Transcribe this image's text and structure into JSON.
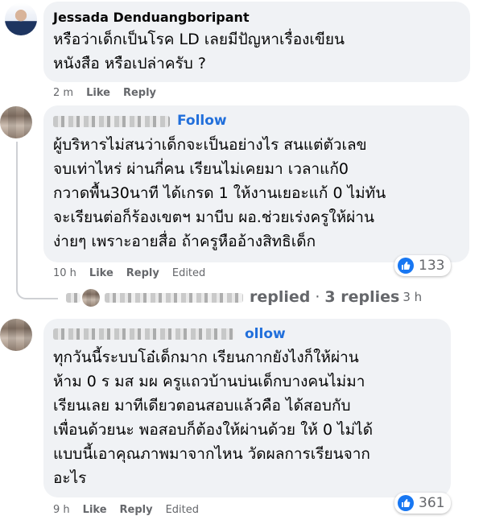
{
  "comments": [
    {
      "author": "Jessada Denduangboripant",
      "text": "หรือว่าเด็กเป็นโรค LD เลยมีปัญหาเรื่องเขียน\nหนังสือ หรือเปล่าครับ ?",
      "time": "2 m",
      "like_label": "Like",
      "reply_label": "Reply"
    },
    {
      "author_hidden": true,
      "follow_label": "Follow",
      "text": "ผู้บริหารไม่สนว่าเด็กจะเป็นอย่างไร สนแต่ตัวเลข\nจบเท่าไหร่ ผ่านกี่คน เรียนไม่เคยมา เวลาแก้0\nกวาดพื้น30นาที ได้เกรด 1 ให้งานเยอะแก้ 0 ไม่ทัน\nจะเรียนต่อก็ร้องเขตฯ มาบีบ ผอ.ช่วยเร่งครูให้ผ่าน\nง่ายๆ เพราะอายสื่อ ถ้าครูหืออ้างสิทธิเด็ก",
      "time": "10 h",
      "like_label": "Like",
      "reply_label": "Reply",
      "edited_label": "Edited",
      "reaction_count": "133",
      "reaction_icon": "thumbs-up-icon",
      "reaction_color": "#1877f2",
      "replies_summary": {
        "replied": "replied",
        "separator": "·",
        "count": "3 replies",
        "time": "3 h"
      }
    },
    {
      "author_hidden": true,
      "follow_label": "ollow",
      "text": "ทุกวันนี้ระบบโอ๋เด็กมาก เรียนกากยังไงก็ให้ผ่าน\nห้าม 0 ร มส มผ ครูแถวบ้านบ่นเด็กบางคนไม่มา\nเรียนเลย มาทีเดียวตอนสอบแล้วคือ ได้สอบกับ\nเพื่อนด้วยนะ พอสอบก็ต้องให้ผ่านด้วย ให้ 0 ไม่ได้\nแบบนี้เอาคุณภาพมาจากไหน วัดผลการเรียนจาก\nอะไร",
      "time": "9 h",
      "like_label": "Like",
      "reply_label": "Reply",
      "edited_label": "Edited",
      "reaction_count": "361",
      "reaction_icon": "thumbs-up-icon",
      "reaction_color": "#1877f2"
    }
  ]
}
